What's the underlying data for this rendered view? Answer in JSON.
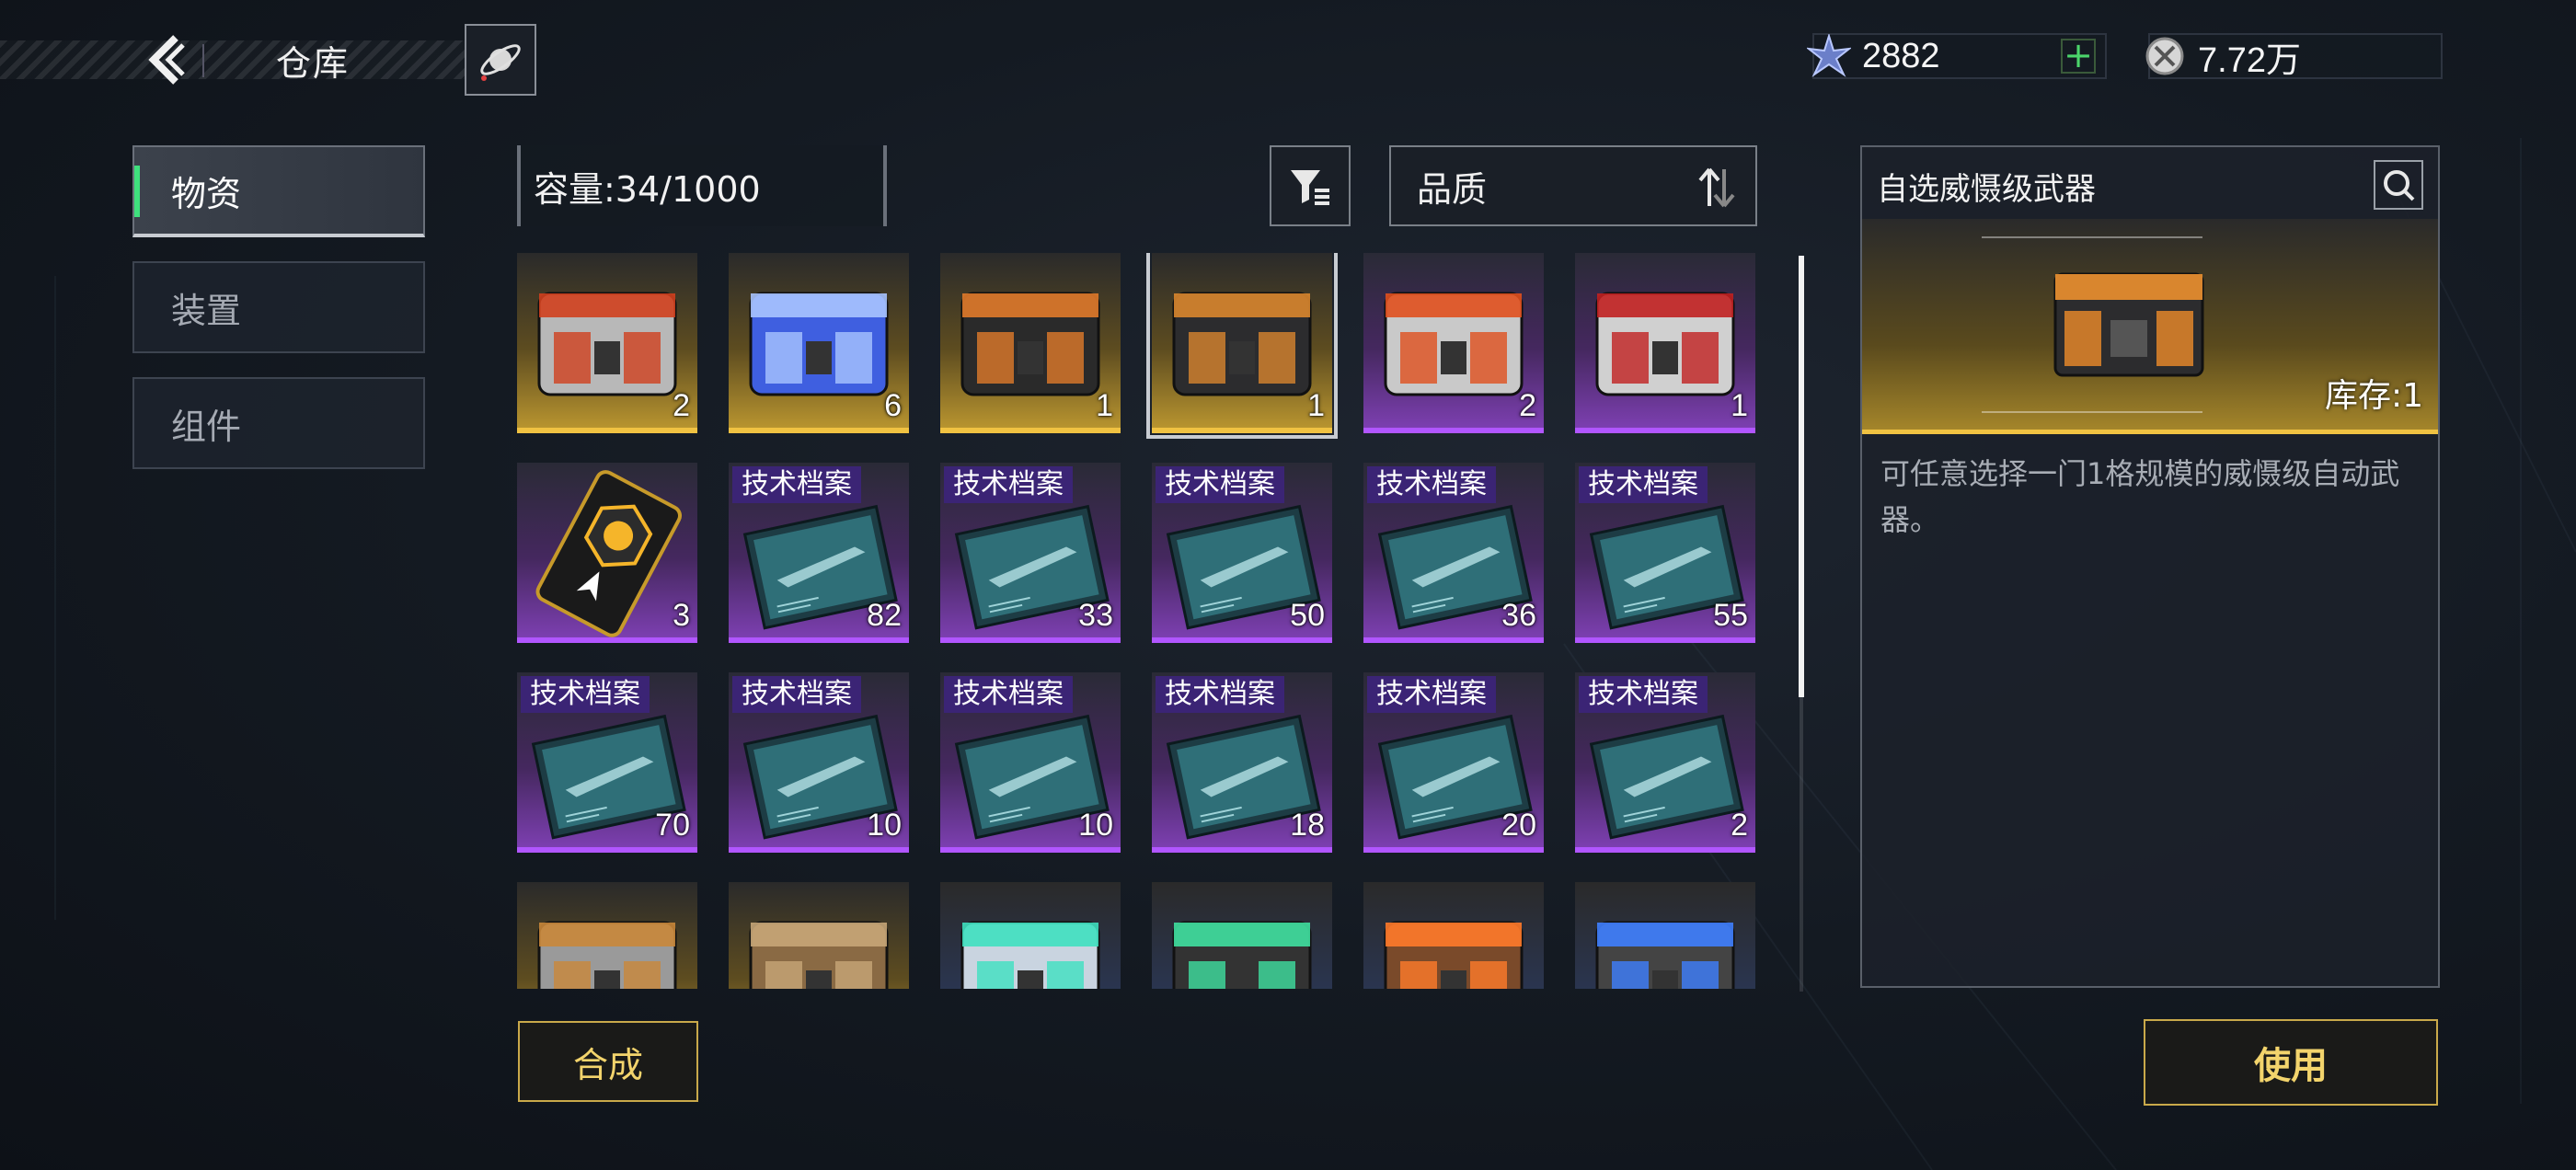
{
  "header": {
    "title": "仓库"
  },
  "currencies": [
    {
      "icon": "crystal-icon",
      "value": "2882",
      "has_add": true,
      "add_label": "+"
    },
    {
      "icon": "coin-icon",
      "value": "7.72万",
      "has_add": false
    }
  ],
  "tabs": [
    {
      "label": "物资",
      "active": true
    },
    {
      "label": "装置",
      "active": false
    },
    {
      "label": "组件",
      "active": false
    }
  ],
  "capacity": "容量:34/1000",
  "sort": {
    "label": "品质"
  },
  "items": [
    {
      "rarity": "gold",
      "icon": "weapon-capsule-icon",
      "qty": "2",
      "tag": ""
    },
    {
      "rarity": "gold",
      "icon": "blue-crystal-box-icon",
      "qty": "6",
      "tag": ""
    },
    {
      "rarity": "gold",
      "icon": "orange-crate-icon",
      "qty": "1",
      "tag": ""
    },
    {
      "rarity": "gold",
      "icon": "weapon-crate-icon",
      "qty": "1",
      "tag": "",
      "selected": true
    },
    {
      "rarity": "purple",
      "icon": "engine-capsule-icon",
      "qty": "2",
      "tag": ""
    },
    {
      "rarity": "purple",
      "icon": "armor-block-icon",
      "qty": "1",
      "tag": ""
    },
    {
      "rarity": "purple",
      "icon": "emblem-card-icon",
      "qty": "3",
      "tag": ""
    },
    {
      "rarity": "purple",
      "icon": "blueprint-icon",
      "qty": "82",
      "tag": "技术档案"
    },
    {
      "rarity": "purple",
      "icon": "blueprint-icon",
      "qty": "33",
      "tag": "技术档案"
    },
    {
      "rarity": "purple",
      "icon": "blueprint-icon",
      "qty": "50",
      "tag": "技术档案"
    },
    {
      "rarity": "purple",
      "icon": "blueprint-icon",
      "qty": "36",
      "tag": "技术档案"
    },
    {
      "rarity": "purple",
      "icon": "blueprint-icon",
      "qty": "55",
      "tag": "技术档案"
    },
    {
      "rarity": "purple",
      "icon": "blueprint-icon",
      "qty": "70",
      "tag": "技术档案"
    },
    {
      "rarity": "purple",
      "icon": "blueprint-icon",
      "qty": "10",
      "tag": "技术档案"
    },
    {
      "rarity": "purple",
      "icon": "blueprint-icon",
      "qty": "10",
      "tag": "技术档案"
    },
    {
      "rarity": "purple",
      "icon": "blueprint-icon",
      "qty": "18",
      "tag": "技术档案"
    },
    {
      "rarity": "purple",
      "icon": "blueprint-icon",
      "qty": "20",
      "tag": "技术档案"
    },
    {
      "rarity": "purple",
      "icon": "blueprint-icon",
      "qty": "2",
      "tag": "技术档案"
    },
    {
      "rarity": "gold",
      "icon": "silver-crate-icon",
      "qty": "",
      "tag": ""
    },
    {
      "rarity": "gold",
      "icon": "ore-chunk-icon",
      "qty": "",
      "tag": ""
    },
    {
      "rarity": "blue",
      "icon": "energy-cell-icon",
      "qty": "",
      "tag": ""
    },
    {
      "rarity": "blue",
      "icon": "green-cell-icon",
      "qty": "",
      "tag": ""
    },
    {
      "rarity": "blue",
      "icon": "core-cube-icon",
      "qty": "",
      "tag": ""
    },
    {
      "rarity": "blue",
      "icon": "blue-module-icon",
      "qty": "",
      "tag": ""
    }
  ],
  "synth_button": "合成",
  "detail": {
    "title": "自选威慑级武器",
    "stock": "库存:1",
    "description": "可任意选择一门1格规模的威慑级自动武器。",
    "icon": "weapon-crate-icon"
  },
  "use_button": "使用",
  "colors": {
    "gold": "#f0c242",
    "purple": "#b156ff",
    "accent_green": "#3fe07d",
    "button_text": "#f3d46c"
  }
}
